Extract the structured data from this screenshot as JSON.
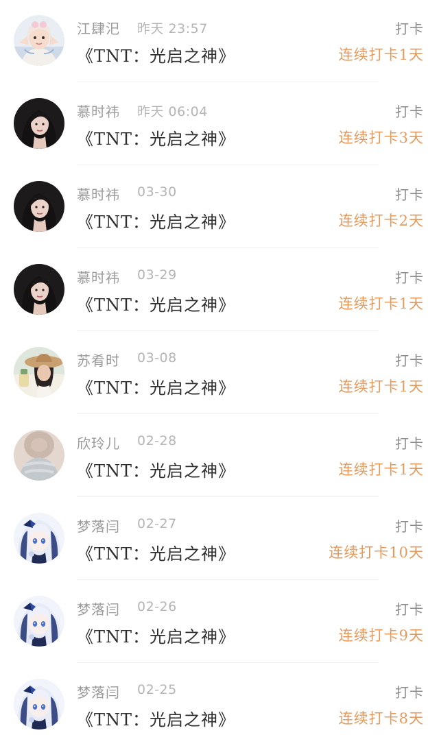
{
  "colors": {
    "name": "#9a9a9a",
    "time": "#b5b5b5",
    "book": "#2e2e2e",
    "action": "#8a8a8a",
    "streak": "#e59a5c",
    "divider": "#f1f1f1"
  },
  "feed": {
    "items": [
      {
        "user": "江肆汜",
        "time": "昨天 23:57",
        "book": "《TNT：光启之神》",
        "action": "打卡",
        "streak": "连续打卡1天",
        "avatar_icon": "girl-selfie-avatar-icon"
      },
      {
        "user": "慕时祎",
        "time": "昨天 06:04",
        "book": "《TNT：光启之神》",
        "action": "打卡",
        "streak": "连续打卡3天",
        "avatar_icon": "dark-hair-portrait-avatar-icon"
      },
      {
        "user": "慕时祎",
        "time": "03-30",
        "book": "《TNT：光启之神》",
        "action": "打卡",
        "streak": "连续打卡2天",
        "avatar_icon": "dark-hair-portrait-avatar-icon"
      },
      {
        "user": "慕时祎",
        "time": "03-29",
        "book": "《TNT：光启之神》",
        "action": "打卡",
        "streak": "连续打卡1天",
        "avatar_icon": "dark-hair-portrait-avatar-icon"
      },
      {
        "user": "苏肴时",
        "time": "03-08",
        "book": "《TNT：光启之神》",
        "action": "打卡",
        "streak": "连续打卡1天",
        "avatar_icon": "hat-girl-avatar-icon"
      },
      {
        "user": "欣玲儿",
        "time": "02-28",
        "book": "《TNT：光启之神》",
        "action": "打卡",
        "streak": "连续打卡1天",
        "avatar_icon": "blurred-portrait-avatar-icon"
      },
      {
        "user": "梦落闫",
        "time": "02-27",
        "book": "《TNT：光启之神》",
        "action": "打卡",
        "streak": "连续打卡10天",
        "avatar_icon": "anime-girl-avatar-icon"
      },
      {
        "user": "梦落闫",
        "time": "02-26",
        "book": "《TNT：光启之神》",
        "action": "打卡",
        "streak": "连续打卡9天",
        "avatar_icon": "anime-girl-avatar-icon"
      },
      {
        "user": "梦落闫",
        "time": "02-25",
        "book": "《TNT：光启之神》",
        "action": "打卡",
        "streak": "连续打卡8天",
        "avatar_icon": "anime-girl-avatar-icon"
      }
    ]
  }
}
